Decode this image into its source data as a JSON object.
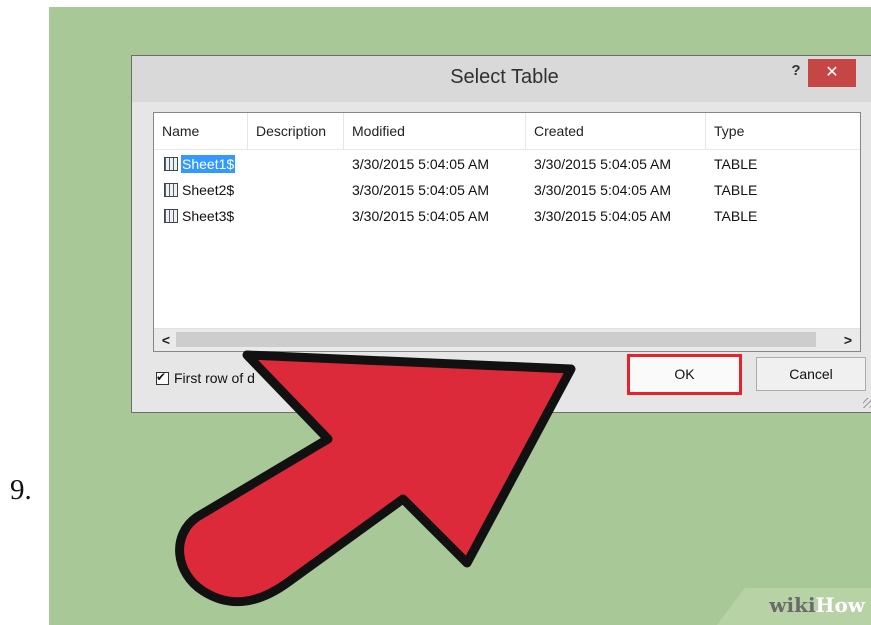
{
  "step": {
    "number": "9."
  },
  "dialog": {
    "title": "Select Table",
    "help_label": "?",
    "close_label": "✕",
    "columns": [
      "Name",
      "Description",
      "Modified",
      "Created",
      "Type"
    ],
    "rows": [
      {
        "name": "Sheet1$",
        "description": "",
        "modified": "3/30/2015 5:04:05 AM",
        "created": "3/30/2015 5:04:05 AM",
        "type": "TABLE",
        "selected": true
      },
      {
        "name": "Sheet2$",
        "description": "",
        "modified": "3/30/2015 5:04:05 AM",
        "created": "3/30/2015 5:04:05 AM",
        "type": "TABLE",
        "selected": false
      },
      {
        "name": "Sheet3$",
        "description": "",
        "modified": "3/30/2015 5:04:05 AM",
        "created": "3/30/2015 5:04:05 AM",
        "type": "TABLE",
        "selected": false
      }
    ],
    "scroll_left": "<",
    "scroll_right": ">",
    "checkbox_label": "First row of d",
    "checkbox_checked": true,
    "ok_label": "OK",
    "cancel_label": "Cancel"
  },
  "branding": {
    "wiki": "wiki",
    "how": "How"
  },
  "colors": {
    "background_green": "#a9c898",
    "highlight_red": "#e8222a",
    "arrow_fill": "#dd2a3a",
    "close_button": "#c64545",
    "selection_blue": "#3399ff"
  },
  "icons": {
    "table_row": "table-icon",
    "pointer": "arrow-pointer"
  }
}
